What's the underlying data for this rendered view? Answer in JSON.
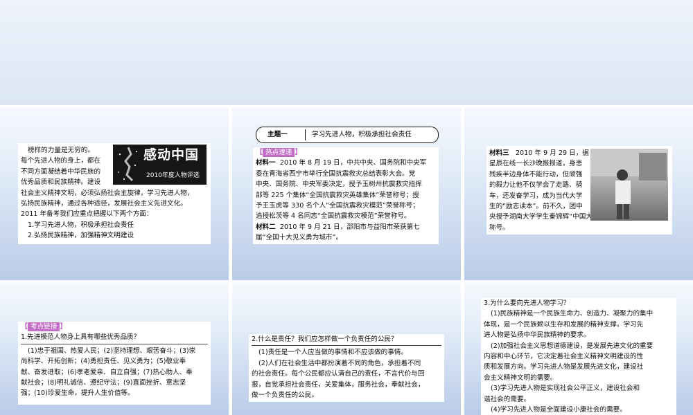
{
  "slides": {
    "s1": {
      "banner": {
        "title": "感动中国",
        "subtitle": "2010年度人物评选"
      },
      "lines": [
        "榜样的力量是无穷的。",
        "每个先进人物的身上，都在",
        "不同方面凝结着中华民族的",
        "优秀品质和民族精神。建设",
        "社会主义精神文明，必须弘扬社会主旋律，学习先进人物，",
        "弘扬民族精神，通过各种途径，发展社会主义先进文化。",
        "2011 年备考我们应重点把握以下两个方面："
      ],
      "points": [
        "1.学习先进人物，积极承担社会责任",
        "2.弘扬民族精神，加强精神文明建设"
      ]
    },
    "s2": {
      "theme_caption": "主题一",
      "theme_text": "学习先进人物，积极承担社会责任",
      "tag": "热点速递",
      "m1_label": "材料一",
      "m1_lines": [
        "2010 年 8 月 19 日，中共中央、国务院和中央军",
        "委在青海省西宁市举行全国抗震救灾总结表彰大会。党",
        "中央、国务院、中央军委决定，授予玉树州抗震救灾指挥",
        "部等 225 个集体“全国抗震救灾英雄集体”荣誉称号；授",
        "予王玉虎等 330 名个人“全国抗震救灾模范”荣誉称号；",
        "追授松茨等 4 名同志“全国抗震救灾模范”荣誉称号。"
      ],
      "m2_label": "材料二",
      "m2_lines": [
        "2010 年 9 月 21 日，邵阳市与益阳市荣获第七",
        "届“全国十大见义勇为城市”。"
      ]
    },
    "s3": {
      "m3_label": "材料三",
      "lines": [
        "2010 年 9 月 29 日，据",
        "星辰在线一长沙晚报报道，身患",
        "残疾半边身体不能行动，但顽强",
        "的毅力让他不仅学会了走路、骑",
        "车，还发奋学习，成为当代大学",
        "生的“励志读本”。前不久，团中",
        "央授予湖南大学学生秦锦辉“中国大学生自强之星”",
        "称号。"
      ]
    },
    "s4": {
      "tag": "考点链接",
      "question": "1.先进模范人物身上具有哪些优秀品质？",
      "lines": [
        "(1)忠于祖国、热爱人民；(2)坚持理想、艰苦奋斗；(3)崇",
        "尚科学、开拓创新；(4)勇担责任、见义勇为；(5)敬业奉",
        "献、奋发进取；(6)孝老爱亲、自立自强；(7)热心助人、奉",
        "献社会；(8)明礼诚信、遵纪守法；(9)直面挫折、意志坚",
        "强；(10)珍爱生命，提升人生价值等。"
      ]
    },
    "s5": {
      "question": "2.什么是责任？我们应怎样做一个负责任的公民？",
      "lines": [
        "(1)责任是一个人应当做的事情和不应该做的事情。",
        "(2)人们在社会生活中都扮演着不同的角色，承担着不同",
        "的社会责任。每个公民都应认清自己的责任，不言代价与回",
        "报，自觉承担社会责任，关爱集体，服务社会，奉献社会，",
        "做一个负责任的公民。"
      ]
    },
    "s6": {
      "question": "3.为什么要向先进人物学习？",
      "lines": [
        "(1)民族精神是一个民族生命力、创造力、凝聚力的集中",
        "体现，是一个民族赖以生存和发展的精神支撑。学习先",
        "进人物是弘扬中华民族精神的要求。",
        "(2)加强社会主义思想道德建设，是发展先进文化的重要",
        "内容和中心环节，它决定着社会主义精神文明建设的性",
        "质和发展方向。学习先进人物是发展先进文化，建设社",
        "会主义精神文明的需要。",
        "(3)学习先进人物是实现社会公平正义，建设社会和",
        "谐社会的需要。",
        "(4)学习先进人物是全面建设小康社会的需要。"
      ]
    }
  }
}
